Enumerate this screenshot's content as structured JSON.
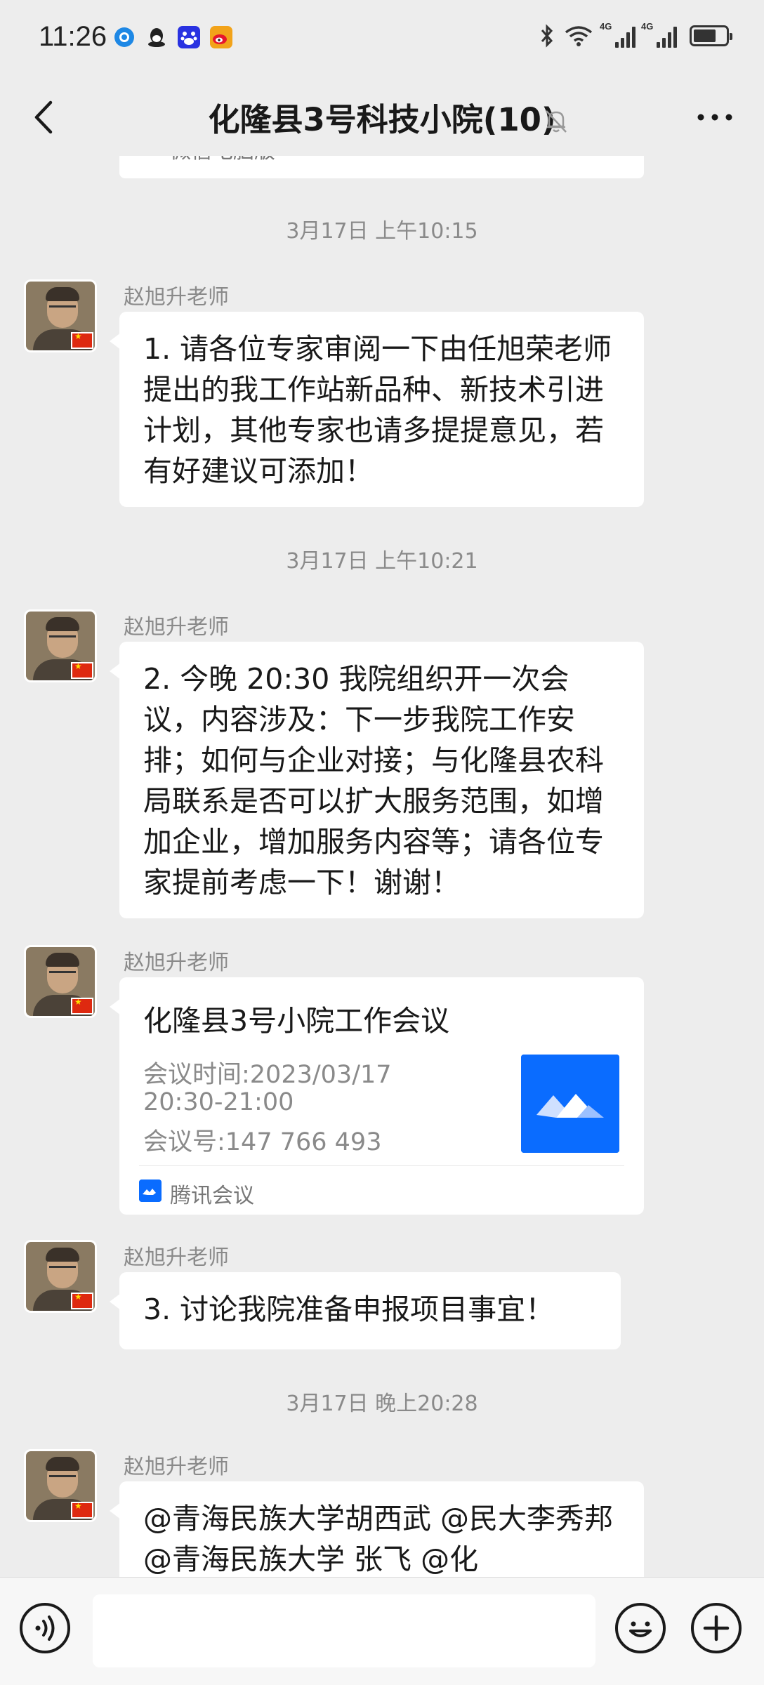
{
  "status_bar": {
    "time": "11:26",
    "signal_1": "4G",
    "signal_2": "4G",
    "battery_level": 0.7
  },
  "header": {
    "title": "化隆县3号科技小院(10)"
  },
  "previous_card": {
    "source": "微信电脑版"
  },
  "messages": [
    {
      "timestamp": "3月17日 上午10:15"
    },
    {
      "sender": "赵旭升老师",
      "text": "1. 请各位专家审阅一下由任旭荣老师提出的我工作站新品种、新技术引进计划，其他专家也请多提提意见，若有好建议可添加！"
    },
    {
      "timestamp": "3月17日 上午10:21"
    },
    {
      "sender": "赵旭升老师",
      "text": "2. 今晚 20:30 我院组织开一次会议，内容涉及：下一步我院工作安排；如何与企业对接；与化隆县农科局联系是否可以扩大服务范围，如增加企业，增加服务内容等；请各位专家提前考虑一下！谢谢！"
    },
    {
      "sender": "赵旭升老师"
    },
    {
      "sender": "赵旭升老师",
      "text": "3. 讨论我院准备申报项目事宜！"
    },
    {
      "timestamp": "3月17日 晚上20:28"
    },
    {
      "sender": "赵旭升老师",
      "text": "@青海民族大学胡西武  @民大李秀邦  @青海民族大学 张飞  @化"
    }
  ],
  "meeting_card": {
    "title": "化隆县3号小院工作会议",
    "time_line_1": "会议时间:2023/03/17",
    "time_line_2": "20:30-21:00",
    "meeting_id": "会议号:147 766 493",
    "source": "腾讯会议"
  },
  "colors": {
    "background": "#ededed",
    "bubble": "#ffffff",
    "tencent_meeting_blue": "#0a6cff"
  }
}
